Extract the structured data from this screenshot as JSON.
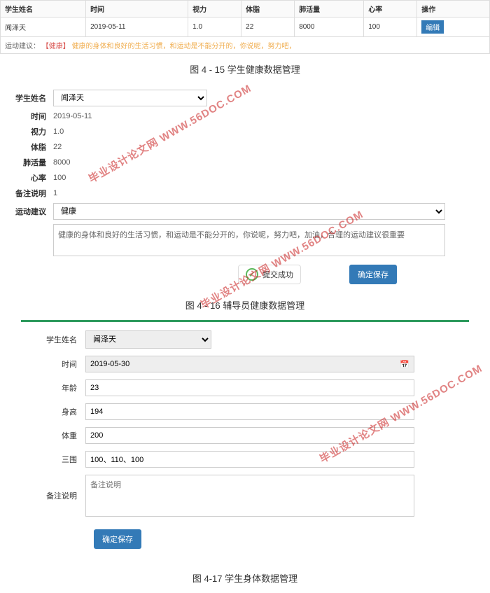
{
  "table": {
    "headers": [
      "学生姓名",
      "时间",
      "视力",
      "体脂",
      "肺活量",
      "心率",
      "操作"
    ],
    "row": {
      "name": "闻泽天",
      "time": "2019-05-11",
      "vision": "1.0",
      "fat": "22",
      "lung": "8000",
      "heart": "100"
    },
    "edit_label": "编辑",
    "suggestion_prefix": "运动建议：",
    "tag": "【健康】",
    "suggestion": "健康的身体和良好的生活习惯，和运动是不能分开的，你说呢，努力吧，"
  },
  "fig1": "图 4 - 15 学生健康数据管理",
  "form1": {
    "labels": {
      "name": "学生姓名",
      "time": "时间",
      "vision": "视力",
      "fat": "体脂",
      "lung": "肺活量",
      "heart": "心率",
      "remark": "备注说明",
      "exercise": "运动建议"
    },
    "values": {
      "name": "闻泽天",
      "time": "2019-05-11",
      "vision": "1.0",
      "fat": "22",
      "lung": "8000",
      "heart": "100",
      "remark": "1"
    },
    "suggest_option": "健康",
    "textarea": "健康的身体和良好的生活习惯，和运动是不能分开的，你说呢，努力吧，加油，合理的运动建议很重要",
    "success": "提交成功",
    "save": "确定保存"
  },
  "fig2": "图 4 - 16 辅导员健康数据管理",
  "form2": {
    "labels": {
      "name": "学生姓名",
      "time": "时间",
      "age": "年龄",
      "height": "身高",
      "weight": "体重",
      "bwh": "三围",
      "remark": "备注说明"
    },
    "values": {
      "name": "闻泽天",
      "time": "2019-05-30",
      "age": "23",
      "height": "194",
      "weight": "200",
      "bwh": "100、110、100"
    },
    "remark_placeholder": "备注说明",
    "save": "确定保存"
  },
  "fig3": "图 4-17 学生身体数据管理",
  "wm": "毕业设计论文网 WWW.56DOC.COM"
}
